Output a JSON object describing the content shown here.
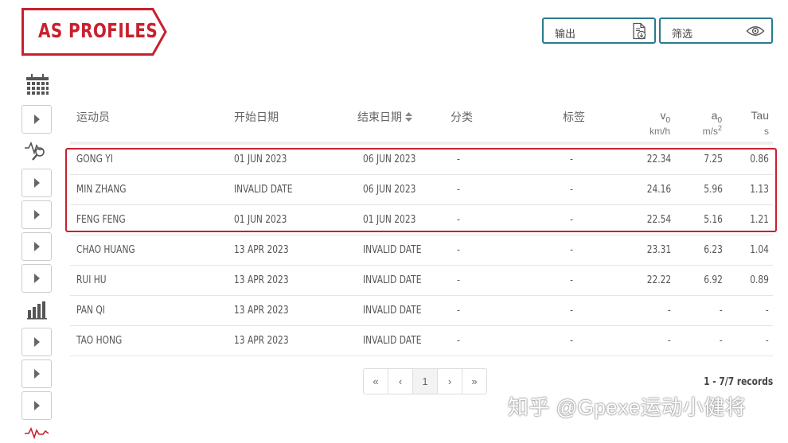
{
  "title": "AS PROFILES",
  "colors": {
    "accent": "#c8202e",
    "teal": "#2a7b8f"
  },
  "toolbar": {
    "export_label": "输出",
    "export_icon": "file-download-icon",
    "filter_label": "筛选",
    "filter_icon": "eye-icon"
  },
  "sidebar": {
    "icons": [
      "calendar-icon",
      "heartbeat-search-icon",
      "bar-chart-icon",
      "heartbeat-icon"
    ]
  },
  "table": {
    "headers": {
      "athlete": "运动员",
      "start_date": "开始日期",
      "end_date": "结束日期",
      "category": "分类",
      "tag": "标签",
      "v0": "v",
      "v0_sub": "0",
      "v0_unit": "km/h",
      "a0": "a",
      "a0_sub": "0",
      "a0_unit": "m/s",
      "a0_unit_sup": "2",
      "tau": "Tau",
      "tau_unit": "s"
    },
    "rows": [
      {
        "name": "GONG YI",
        "start": "01 JUN 2023",
        "end": "06 JUN 2023",
        "category": "-",
        "tag": "-",
        "v0": "22.34",
        "a0": "7.25",
        "tau": "0.86"
      },
      {
        "name": "MIN ZHANG",
        "start": "INVALID DATE",
        "end": "06 JUN 2023",
        "category": "-",
        "tag": "-",
        "v0": "24.16",
        "a0": "5.96",
        "tau": "1.13"
      },
      {
        "name": "FENG FENG",
        "start": "01 JUN 2023",
        "end": "01 JUN 2023",
        "category": "-",
        "tag": "-",
        "v0": "22.54",
        "a0": "5.16",
        "tau": "1.21"
      },
      {
        "name": "CHAO HUANG",
        "start": "13 APR 2023",
        "end": "INVALID DATE",
        "category": "-",
        "tag": "-",
        "v0": "23.31",
        "a0": "6.23",
        "tau": "1.04"
      },
      {
        "name": "RUI HU",
        "start": "13 APR 2023",
        "end": "INVALID DATE",
        "category": "-",
        "tag": "-",
        "v0": "22.22",
        "a0": "6.92",
        "tau": "0.89"
      },
      {
        "name": "PAN QI",
        "start": "13 APR 2023",
        "end": "INVALID DATE",
        "category": "-",
        "tag": "-",
        "v0": "-",
        "a0": "-",
        "tau": "-"
      },
      {
        "name": "TAO HONG",
        "start": "13 APR 2023",
        "end": "INVALID DATE",
        "category": "-",
        "tag": "-",
        "v0": "-",
        "a0": "-",
        "tau": "-"
      }
    ]
  },
  "pagination": {
    "first": "«",
    "prev": "‹",
    "page": "1",
    "next": "›",
    "last": "»",
    "records": "1 - 7/7 records"
  },
  "watermark": "知乎 @Gpexe运动小健将"
}
